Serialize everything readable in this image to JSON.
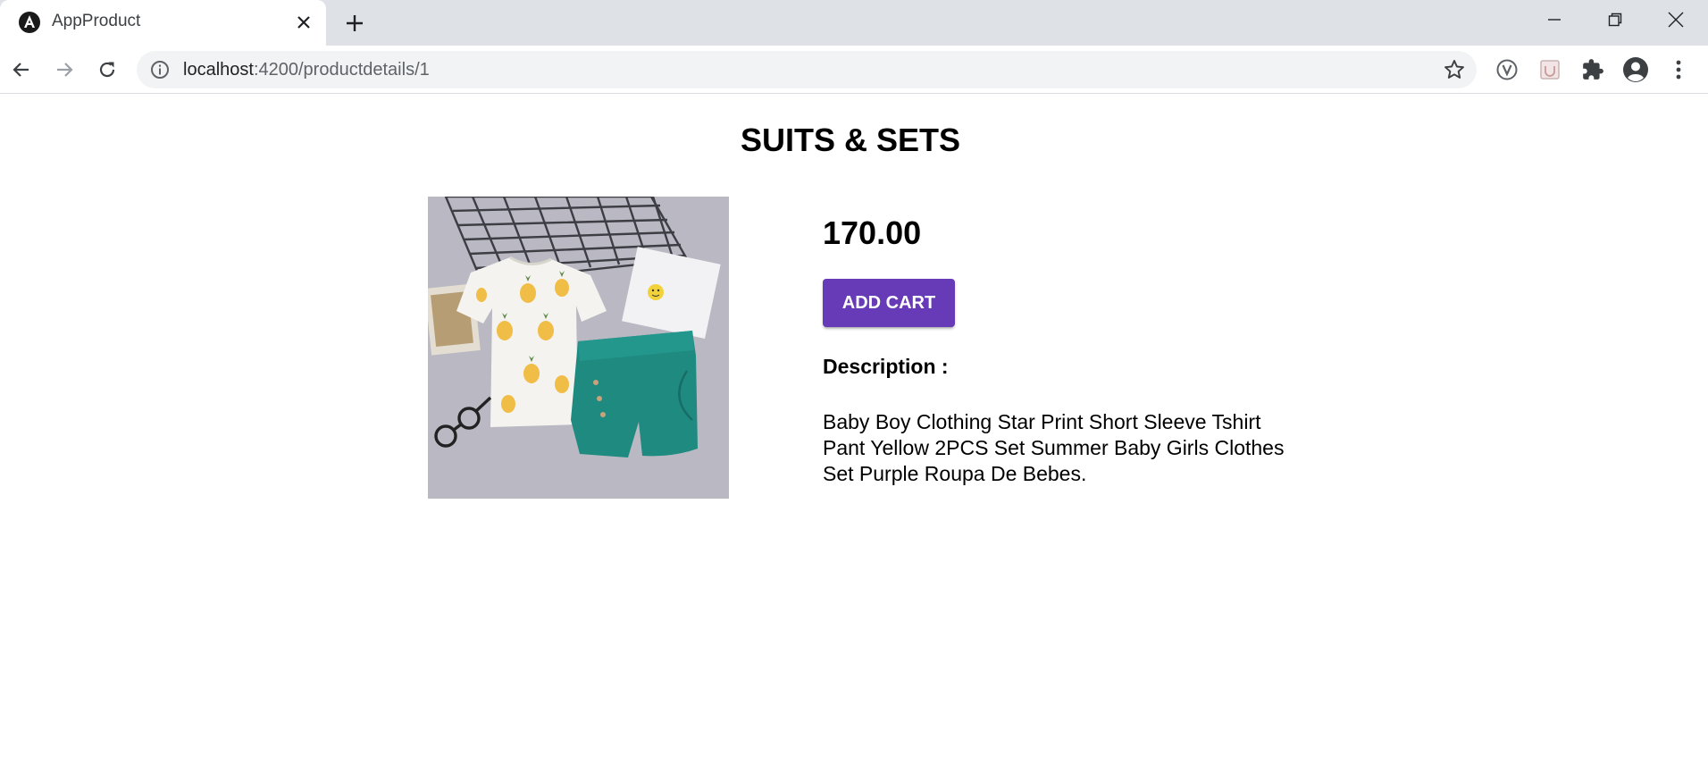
{
  "browser": {
    "tab": {
      "title": "AppProduct",
      "favicon": "angular-icon",
      "close_icon": "close-icon"
    },
    "new_tab_icon": "plus-icon",
    "window_controls": [
      "minimize-icon",
      "restore-icon",
      "close-icon"
    ],
    "address": {
      "host": "localhost",
      "rest": ":4200/productdetails/1"
    },
    "toolbar_icons": [
      "back-icon",
      "forward-icon",
      "reload-icon",
      "info-icon",
      "star-icon",
      "vpn-extension-icon",
      "extension-icon",
      "puzzle-icon",
      "profile-icon",
      "menu-icon"
    ]
  },
  "product": {
    "category_title": "SUITS & SETS",
    "price": "170.00",
    "add_cart_label": "ADD CART",
    "description_label": "Description :",
    "description": "Baby Boy Clothing Star Print Short Sleeve Tshirt Pant Yellow 2PCS Set Summer Baby Girls Clothes Set Purple Roupa De Bebes."
  },
  "colors": {
    "accent": "#673ab7",
    "tabstrip": "#dee1e6",
    "omnibox": "#f1f3f4"
  }
}
